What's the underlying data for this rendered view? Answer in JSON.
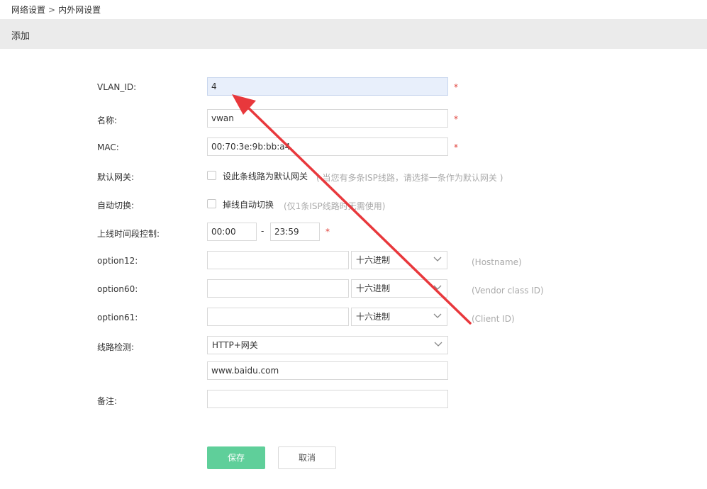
{
  "breadcrumb": {
    "parent": "网络设置",
    "separator": ">",
    "current": "内外网设置"
  },
  "panel": {
    "title": "添加"
  },
  "form": {
    "vlan_id": {
      "label": "VLAN_ID:",
      "value": "4",
      "required": "*"
    },
    "name": {
      "label": "名称:",
      "value": "vwan",
      "required": "*"
    },
    "mac": {
      "label": "MAC:",
      "value": "00:70:3e:9b:bb:a4",
      "required": "*"
    },
    "default_gateway": {
      "label": "默认网关:",
      "checkbox_label": "设此条线路为默认网关",
      "hint": "( 当您有多条ISP线路，请选择一条作为默认网关 )"
    },
    "auto_switch": {
      "label": "自动切换:",
      "checkbox_label": "掉线自动切换",
      "hint": "(仅1条ISP线路时无需使用)"
    },
    "online_time": {
      "label": "上线时间段控制:",
      "start": "00:00",
      "dash": "-",
      "end": "23:59",
      "required": "*"
    },
    "option12": {
      "label": "option12:",
      "value": "",
      "encoding": "十六进制",
      "hint": "(Hostname)"
    },
    "option60": {
      "label": "option60:",
      "value": "",
      "encoding": "十六进制",
      "hint": "(Vendor class ID)"
    },
    "option61": {
      "label": "option61:",
      "value": "",
      "encoding": "十六进制",
      "hint": "(Client ID)"
    },
    "line_check": {
      "label": "线路检测:",
      "method": "HTTP+网关",
      "host": "www.baidu.com"
    },
    "remark": {
      "label": "备注:",
      "value": ""
    }
  },
  "buttons": {
    "save": "保存",
    "cancel": "取消"
  },
  "colors": {
    "accent_green": "#5fcf9a",
    "required_red": "#e0423b",
    "annotation_arrow": "#e8383c",
    "focused_input_bg": "#e8effb"
  },
  "annotation": {
    "type": "arrow",
    "color": "#e8383c"
  }
}
